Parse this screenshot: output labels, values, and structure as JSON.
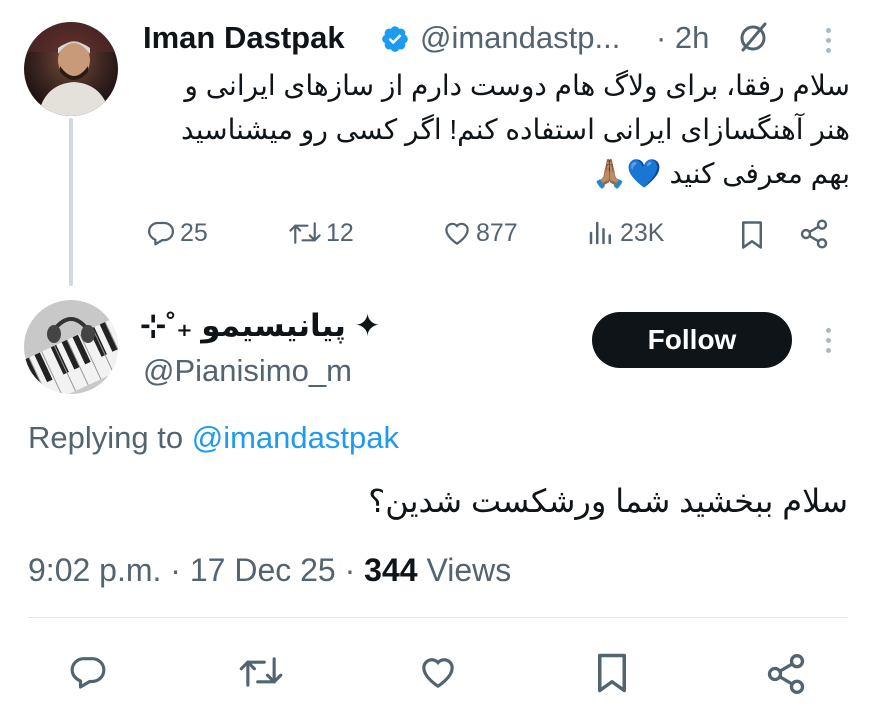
{
  "original_tweet": {
    "author_name": "Iman Dastpak",
    "author_handle": "@imandastp...",
    "time": "· 2h",
    "text_line1": "سلام رفقا، برای ولاگ هام دوست دارم از سازهای ایرانی و",
    "text_line2": "هنر آهنگسازای ایرانی استفاده کنم! اگر کسی رو میشناسید",
    "text_line3": "بهم معرفی کنید 💙🙏🏽",
    "replies": "25",
    "reposts": "12",
    "likes": "877",
    "views": "23K"
  },
  "reply": {
    "author_name": "✦ پیانیسیمو ₊˚⊹",
    "author_handle": "@Pianisimo_m",
    "follow_label": "Follow",
    "replying_prefix": "Replying to",
    "replying_handle": "@imandastpak",
    "text": "سلام ببخشید شما ورشکست شدین؟",
    "time": "9:02 p.m.",
    "date": "· 17 Dec 25 ·",
    "views_count": "344",
    "views_label": "Views"
  },
  "colors": {
    "verified": "#1d9bf0",
    "link": "#1d9bf0",
    "muted": "#536471",
    "follow_bg": "#0f1419"
  }
}
